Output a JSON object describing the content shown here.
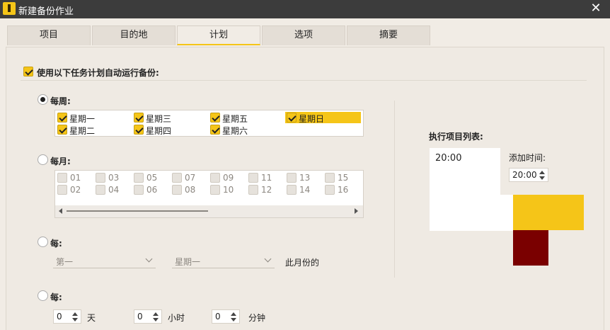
{
  "window": {
    "title": "新建备份作业",
    "close_icon": "close-icon"
  },
  "tabs": [
    {
      "label": "项目"
    },
    {
      "label": "目的地"
    },
    {
      "label": "计划",
      "active": true
    },
    {
      "label": "选项"
    },
    {
      "label": "摘要"
    }
  ],
  "auto_run": {
    "label": "使用以下任务计划自动运行备份:",
    "checked": true
  },
  "weekly": {
    "label": "每周:",
    "selected": true,
    "days": [
      {
        "label": "星期一",
        "checked": true
      },
      {
        "label": "星期二",
        "checked": true
      },
      {
        "label": "星期三",
        "checked": true
      },
      {
        "label": "星期四",
        "checked": true
      },
      {
        "label": "星期五",
        "checked": true
      },
      {
        "label": "星期六",
        "checked": true
      },
      {
        "label": "星期日",
        "checked": true,
        "highlighted": true
      }
    ]
  },
  "monthly": {
    "label": "每月:",
    "selected": false,
    "days": [
      "01",
      "02",
      "03",
      "04",
      "05",
      "06",
      "07",
      "08",
      "09",
      "10",
      "11",
      "12",
      "13",
      "14",
      "15",
      "16"
    ]
  },
  "every_nth": {
    "label": "每:",
    "selected": false,
    "ordinal_value": "第一",
    "weekday_value": "星期一",
    "suffix": "此月份的"
  },
  "every_interval": {
    "label": "每:",
    "selected": false,
    "days_value": "0",
    "days_unit": "天",
    "hours_value": "0",
    "hours_unit": "小时",
    "minutes_value": "0",
    "minutes_unit": "分钟"
  },
  "execution_list": {
    "label": "执行项目列表:",
    "items": [
      "20:00"
    ],
    "add_time_label": "添加时间:",
    "add_time_value": "20:00"
  },
  "colors": {
    "accent": "#f5c518",
    "dark_red": "#7a0000",
    "titlebar": "#3c3c3c"
  }
}
